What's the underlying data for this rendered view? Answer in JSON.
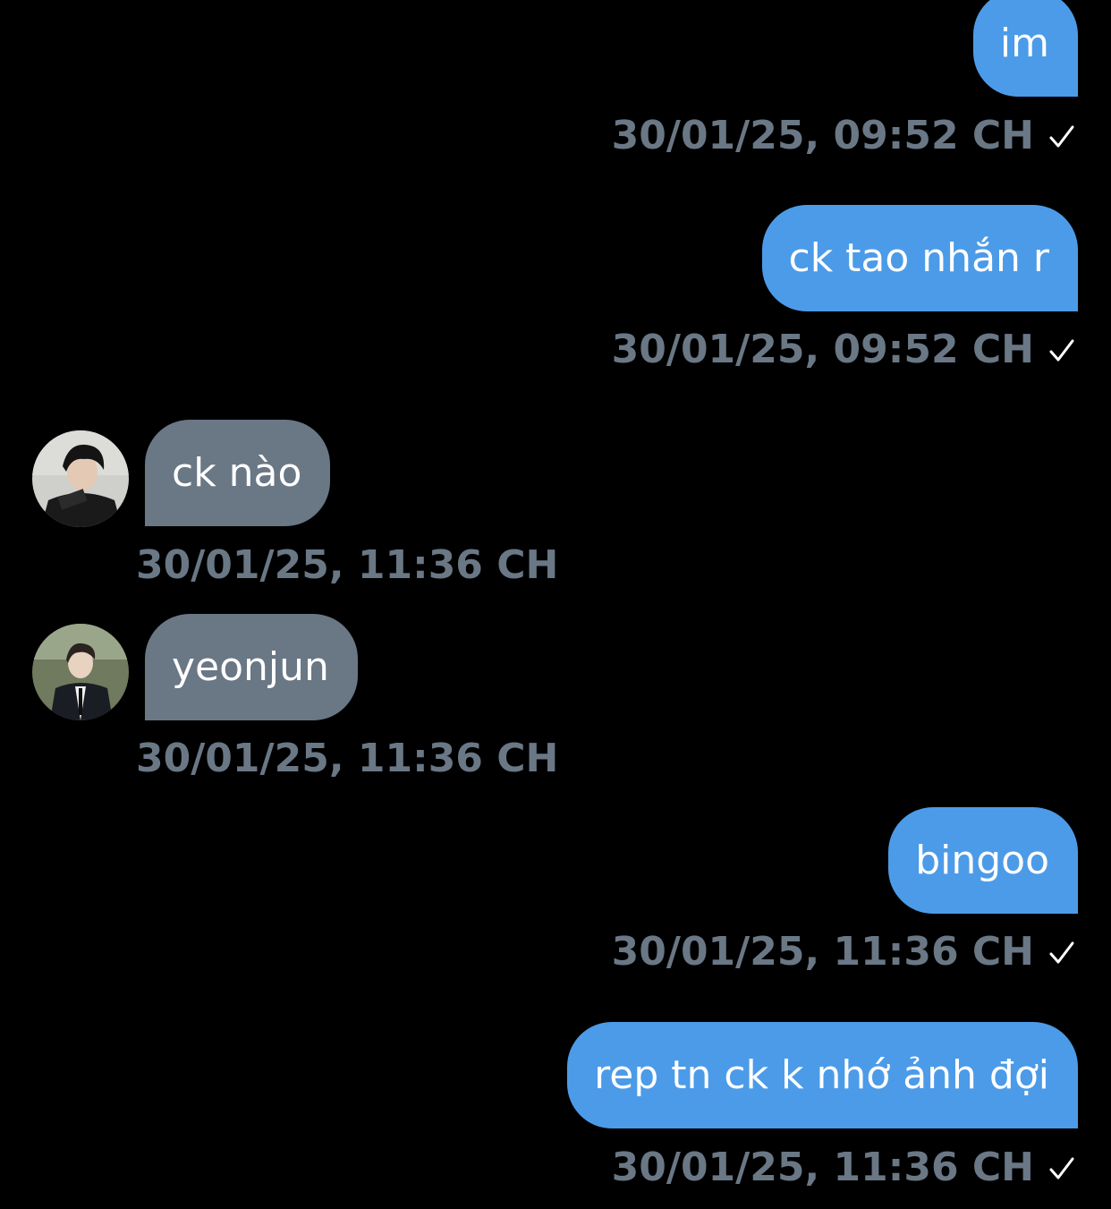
{
  "colors": {
    "background": "#000000",
    "outgoing_bubble": "#4c9be8",
    "incoming_bubble": "#6a7785",
    "timestamp": "#6a7785"
  },
  "messages": [
    {
      "direction": "outgoing",
      "text": "im",
      "timestamp": "30/01/25, 09:52 CH",
      "status_icon": "check-icon"
    },
    {
      "direction": "outgoing",
      "text": "ck tao nhắn r",
      "timestamp": "30/01/25, 09:52 CH",
      "status_icon": "check-icon"
    },
    {
      "direction": "incoming",
      "text": "ck nào",
      "timestamp": "30/01/25, 11:36 CH",
      "avatar": "user-avatar"
    },
    {
      "direction": "incoming",
      "text": "yeonjun",
      "timestamp": "30/01/25, 11:36 CH",
      "avatar": "user-avatar"
    },
    {
      "direction": "outgoing",
      "text": "bingoo",
      "timestamp": "30/01/25, 11:36 CH",
      "status_icon": "check-icon"
    },
    {
      "direction": "outgoing",
      "text": "rep tn ck k nhớ ảnh đợi",
      "timestamp": "30/01/25, 11:36 CH",
      "status_icon": "check-icon"
    }
  ]
}
